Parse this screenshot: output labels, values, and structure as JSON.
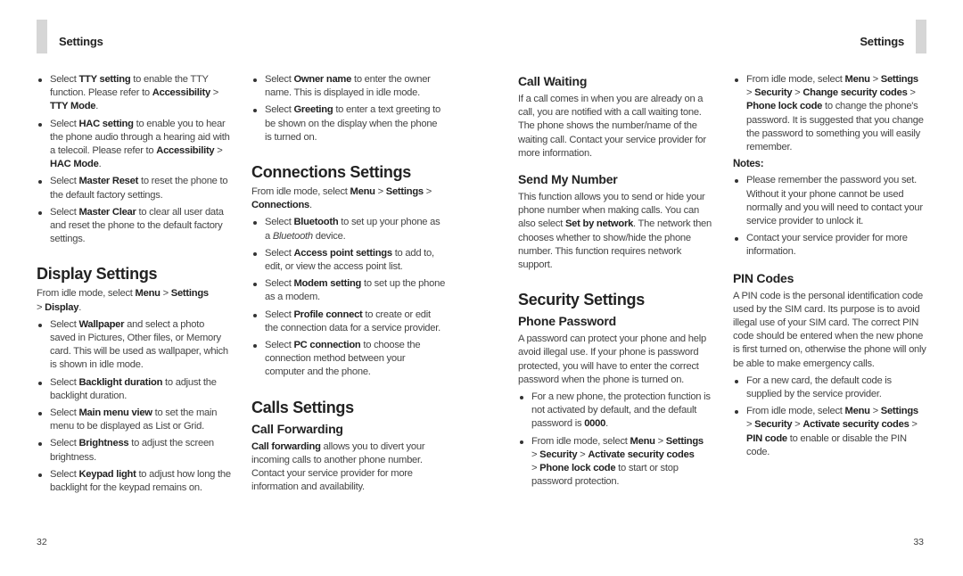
{
  "header": {
    "left_title": "Settings",
    "right_title": "Settings"
  },
  "footer": {
    "left_page": "32",
    "right_page": "33"
  },
  "col1": {
    "items": [
      {
        "pre": "Select ",
        "bold": "TTY setting",
        "post": " to enable the TTY function. Please refer to ",
        "bold2": "Accessibility",
        "mid": " > ",
        "bold3": "TTY Mode",
        "end": "."
      },
      {
        "pre": "Select ",
        "bold": "HAC setting",
        "post": " to enable you to hear the phone audio through a hearing aid with a telecoil. Please refer to ",
        "bold2": "Accessibility",
        "mid": " > ",
        "bold3": "HAC Mode",
        "end": "."
      },
      {
        "pre": "Select ",
        "bold": "Master Reset",
        "post": " to reset the phone to the default factory settings."
      },
      {
        "pre": "Select ",
        "bold": "Master Clear",
        "post": " to clear all user data and reset the phone to the default factory settings."
      }
    ],
    "display": {
      "title": "Display Settings",
      "intro_pre": "From idle mode, select ",
      "intro_b1": "Menu",
      "intro_sep1": " > ",
      "intro_b2": "Settings",
      "intro_sep2": " > ",
      "intro_b3": "Display",
      "intro_end": ".",
      "items": [
        {
          "pre": "Select ",
          "bold": "Wallpaper",
          "post": " and select a photo saved in Pictures, Other files, or Memory card. This will be used as wallpaper, which is shown in idle mode."
        },
        {
          "pre": "Select ",
          "bold": "Backlight duration",
          "post": " to adjust the backlight duration."
        },
        {
          "pre": "Select ",
          "bold": "Main menu view",
          "post": " to set the main menu to be displayed as List or Grid."
        },
        {
          "pre": "Select ",
          "bold": "Brightness",
          "post": " to adjust the screen brightness."
        },
        {
          "pre": "Select ",
          "bold": "Keypad light",
          "post": " to adjust how long the backlight for the keypad remains on."
        }
      ]
    }
  },
  "col2": {
    "items": [
      {
        "pre": "Select ",
        "bold": "Owner name",
        "post": " to enter the owner name. This is displayed in idle mode."
      },
      {
        "pre": "Select ",
        "bold": "Greeting",
        "post": " to enter a text greeting to be shown on the display when the phone is turned on."
      }
    ],
    "connections": {
      "title": "Connections Settings",
      "intro_pre": "From idle mode, select ",
      "intro_b1": "Menu",
      "intro_sep1": " > ",
      "intro_b2": "Settings",
      "intro_sep2": " > ",
      "intro_b3": "Connections",
      "intro_end": ".",
      "bluetooth": {
        "pre": "Select ",
        "bold": "Bluetooth",
        "post": " to set up your phone as a ",
        "italic": "Bluetooth",
        "end": " device."
      },
      "items": [
        {
          "pre": "Select ",
          "bold": "Access point settings",
          "post": " to add to, edit, or view the access point list."
        },
        {
          "pre": "Select ",
          "bold": "Modem setting",
          "post": " to set up the phone as a modem."
        },
        {
          "pre": "Select ",
          "bold": "Profile connect",
          "post": " to create or edit the connection data for a service provider."
        },
        {
          "pre": "Select ",
          "bold": "PC connection",
          "post": " to choose the connection method between your computer and the phone."
        }
      ]
    },
    "calls": {
      "title": "Calls Settings",
      "forwarding_title": "Call Forwarding",
      "forwarding_bold": "Call forwarding",
      "forwarding_text": " allows you to divert your incoming calls to another phone number. Contact your service provider for more information and availability."
    }
  },
  "col3": {
    "waiting": {
      "title": "Call Waiting",
      "text": "If a call comes in when you are already on a call, you are notified with a call waiting tone. The phone shows the number/name of the waiting call. Contact your service provider for more information."
    },
    "send_number": {
      "title": "Send My Number",
      "pre": "This function allows you to send or hide your phone number when making calls. You can also select ",
      "bold": "Set by network",
      "post": ". The network then chooses whether to show/hide the phone number. This function requires network support."
    },
    "security": {
      "title": "Security Settings",
      "password_title": "Phone Password",
      "password_text": "A password can protect your phone and help avoid illegal use. If your phone is password protected, you will have to enter the correct password when the phone is turned on.",
      "item1_pre": "For a new phone, the protection function is not activated by default, and the default password is ",
      "item1_bold": "0000",
      "item1_end": ".",
      "item2_pre": "From idle mode, select ",
      "item2_b1": "Menu",
      "item2_b2": "Settings",
      "item2_b3": "Security",
      "item2_b4": "Activate security codes",
      "item2_b5": "Phone lock code",
      "item2_sep": " > ",
      "item2_end": " to start or stop password protection."
    }
  },
  "col4": {
    "change": {
      "pre": "From idle mode, select ",
      "b1": "Menu",
      "b2": "Settings",
      "b3": "Security",
      "b4": "Change security codes",
      "b5": "Phone lock code",
      "sep": " > ",
      "end": " to change the phone's password. It is suggested that you change the password to something you will easily remember."
    },
    "notes": {
      "title": "Notes:",
      "items": [
        "Please remember the password you set. Without it your phone cannot be used normally and you will need to contact your service provider to unlock it.",
        "Contact your service provider for more information."
      ]
    },
    "pin": {
      "title": "PIN Codes",
      "text": "A PIN code is the personal identification code used by the SIM card. Its purpose is to avoid illegal use of your SIM card. The correct PIN code should be entered when the new phone is first turned on, otherwise the phone will only be able to make emergency calls.",
      "item1": "For a new card, the default code is supplied by the service provider.",
      "item2_pre": "From idle mode, select ",
      "item2_b1": "Menu",
      "item2_b2": "Settings",
      "item2_b3": "Security",
      "item2_b4": "Activate security codes",
      "item2_b5": "PIN code",
      "item2_sep": " > ",
      "item2_end": " to enable or disable the PIN code."
    }
  }
}
